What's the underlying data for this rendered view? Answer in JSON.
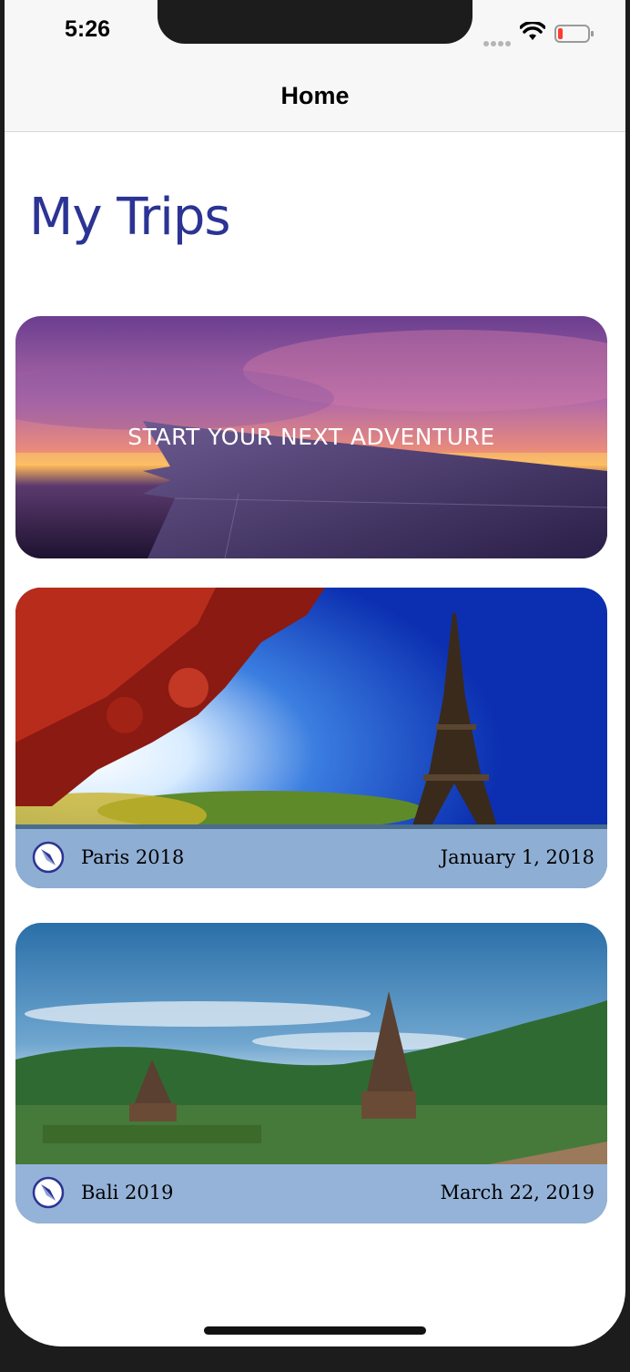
{
  "status_bar": {
    "time": "5:26"
  },
  "nav": {
    "title": "Home"
  },
  "page": {
    "title": "My Trips"
  },
  "hero_card": {
    "label": "START YOUR NEXT ADVENTURE"
  },
  "trips": [
    {
      "name": "Paris 2018",
      "date": "January 1, 2018"
    },
    {
      "name": "Bali 2019",
      "date": "March 22, 2019"
    }
  ],
  "colors": {
    "title": "#2b3494",
    "footer": "#aac8f0",
    "compass": "#2b3494"
  },
  "icons": {
    "status": [
      "signal-icon",
      "wifi-icon",
      "battery-icon"
    ],
    "trip": "compass-icon"
  }
}
